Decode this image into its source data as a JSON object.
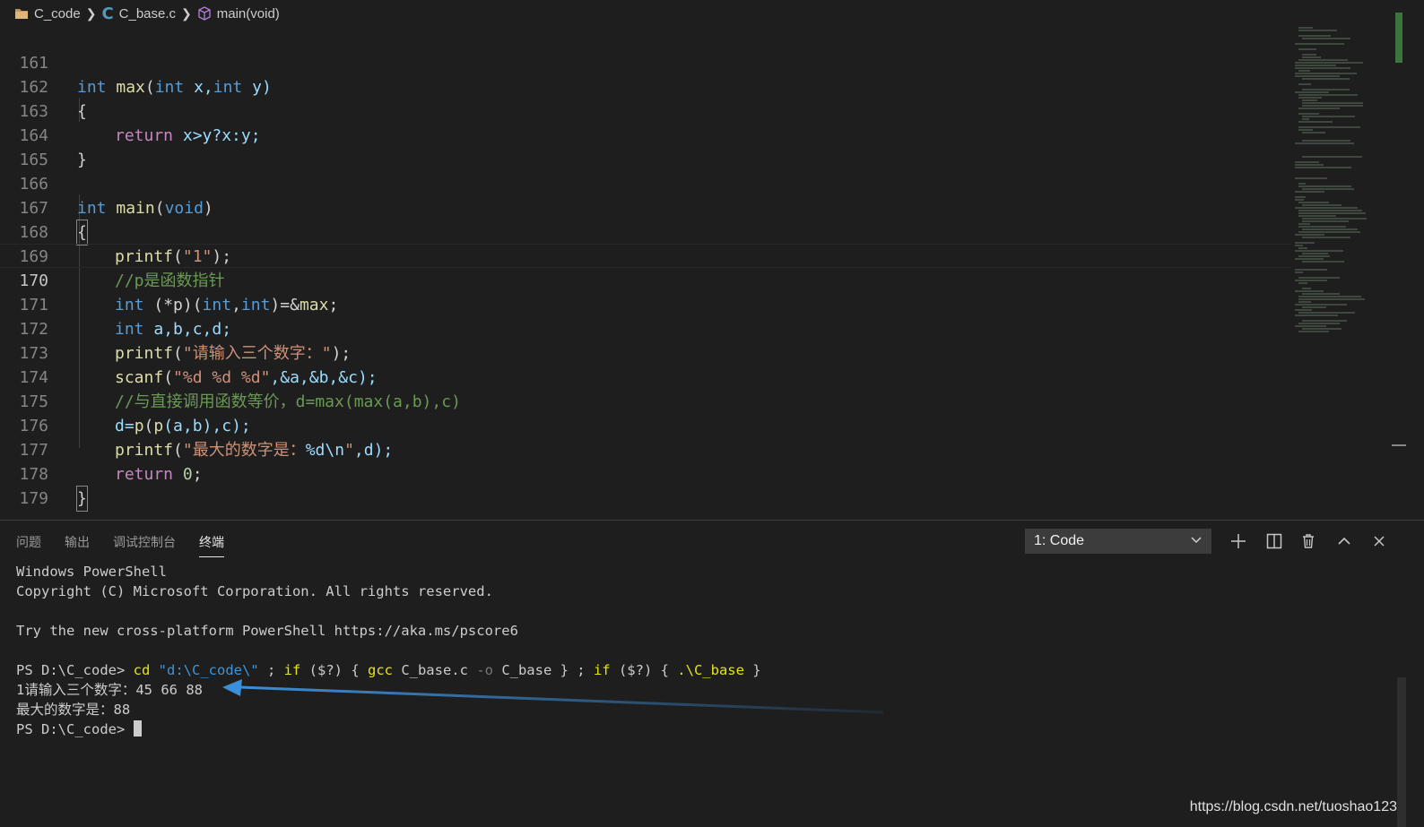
{
  "breadcrumb": {
    "folder": "C_code",
    "file_icon": "C",
    "file": "C_base.c",
    "symbol": "main(void)"
  },
  "editor": {
    "lines": [
      {
        "n": "161"
      },
      {
        "n": "162"
      },
      {
        "n": "163"
      },
      {
        "n": "164"
      },
      {
        "n": "165"
      },
      {
        "n": "166"
      },
      {
        "n": "167"
      },
      {
        "n": "168"
      },
      {
        "n": "169"
      },
      {
        "n": "170"
      },
      {
        "n": "171"
      },
      {
        "n": "172"
      },
      {
        "n": "173"
      },
      {
        "n": "174"
      },
      {
        "n": "175"
      },
      {
        "n": "176"
      },
      {
        "n": "177"
      },
      {
        "n": "178"
      },
      {
        "n": "179"
      }
    ],
    "code": {
      "l161_kw1": "int",
      "l161_fn": "max",
      "l161_p": "(",
      "l161_kw2": "int",
      "l161_x": " x,",
      "l161_kw3": "int",
      "l161_y": " y)",
      "l162": "{",
      "l163_ret": "return",
      "l163_rest": " x>y?x:y;",
      "l164": "}",
      "l166_kw": "int",
      "l166_fn": "main",
      "l166_p1": "(",
      "l166_void": "void",
      "l166_p2": ")",
      "l167": "{",
      "l168_fn": "printf",
      "l168_p1": "(",
      "l168_str": "\"1\"",
      "l168_p2": ");",
      "l169_cmt": "//p是函数指针",
      "l170_kw": "int",
      "l170_a": " (*p)(",
      "l170_kw2": "int",
      "l170_c": ",",
      "l170_kw3": "int",
      "l170_b": ")=&",
      "l170_fn": "max",
      "l170_e": ";",
      "l171_kw": "int",
      "l171_rest": " a,b,c,d;",
      "l172_fn": "printf",
      "l172_p1": "(",
      "l172_str": "\"请输入三个数字：\"",
      "l172_p2": ");",
      "l173_fn": "scanf",
      "l173_p1": "(",
      "l173_str": "\"%d %d %d\"",
      "l173_rest": ",&a,&b,&c);",
      "l174_cmt": "//与直接调用函数等价，d=max(max(a,b),c)",
      "l175_a": "d=",
      "l175_fn1": "p",
      "l175_b": "(",
      "l175_fn2": "p",
      "l175_c": "(a,b),c);",
      "l176_fn": "printf",
      "l176_p1": "(",
      "l176_str1": "\"最大的数字是：",
      "l176_fmt": "%d\\n",
      "l176_str2": "\"",
      "l176_rest": ",d);",
      "l177_ret": "return",
      "l177_sp": " ",
      "l177_num": "0",
      "l177_e": ";",
      "l178": "}"
    }
  },
  "panel": {
    "tabs": [
      "问题",
      "输出",
      "调试控制台",
      "终端"
    ],
    "active_tab": "终端",
    "terminal_select": "1: Code",
    "terminal": {
      "l1": "Windows PowerShell",
      "l2": "Copyright (C) Microsoft Corporation. All rights reserved.",
      "l3": "",
      "l4": "Try the new cross-platform PowerShell https://aka.ms/pscore6",
      "l5": "",
      "prompt": "PS D:\\C_code> ",
      "cmd_cd": "cd",
      "cmd_path": "\"d:\\C_code\\\"",
      "cmd_semi1": " ; ",
      "cmd_if1": "if",
      "cmd_cond1": " ($?) { ",
      "cmd_gcc": "gcc",
      "cmd_src": " C_base.c ",
      "cmd_o": "-o",
      "cmd_out": " C_base } ; ",
      "cmd_if2": "if",
      "cmd_cond2": " ($?) { ",
      "cmd_run": ".\\C_base",
      "cmd_end": " }",
      "out1": "1请输入三个数字：45 66 88",
      "out2": "最大的数字是：88",
      "prompt2": "PS D:\\C_code> "
    }
  },
  "watermark": "https://blog.csdn.net/tuoshao123",
  "colors": {
    "arrow": "#3b8fd9",
    "keyword": "#569cd6",
    "function": "#dcdcaa",
    "string": "#ce9178",
    "comment": "#6a9955"
  }
}
